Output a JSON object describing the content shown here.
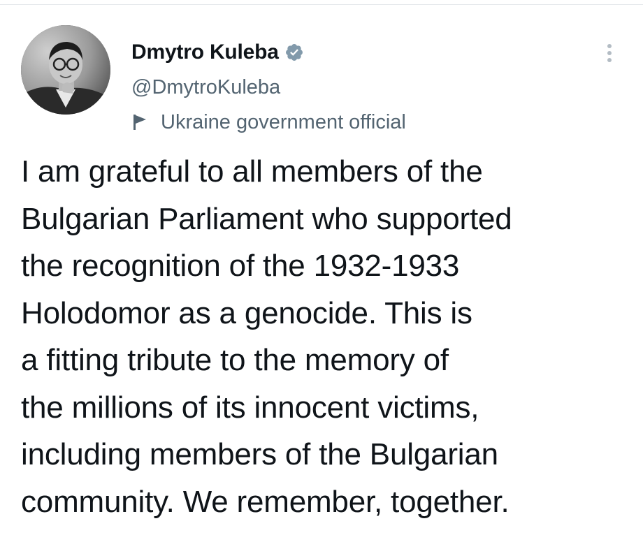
{
  "author": {
    "display_name": "Dmytro Kuleba",
    "handle": "@DmytroKuleba",
    "label": "Ukraine government official",
    "verified": true,
    "avatar_icon": "profile-photo",
    "verified_icon": "verified-badge-icon",
    "label_icon": "flag-icon"
  },
  "tweet": {
    "lines": [
      "I am grateful to all members of the",
      "Bulgarian Parliament who supported",
      "the recognition of the 1932-1933",
      "Holodomor as a genocide. This is",
      "a fitting tribute to the memory of",
      "the millions of its innocent victims,",
      "including members of the Bulgarian",
      "community. We remember, together."
    ]
  },
  "menu": {
    "icon": "more-options-icon"
  },
  "colors": {
    "text_primary": "#0f1419",
    "text_secondary": "#536471",
    "verified_badge": "#829aab",
    "background": "#ffffff"
  }
}
